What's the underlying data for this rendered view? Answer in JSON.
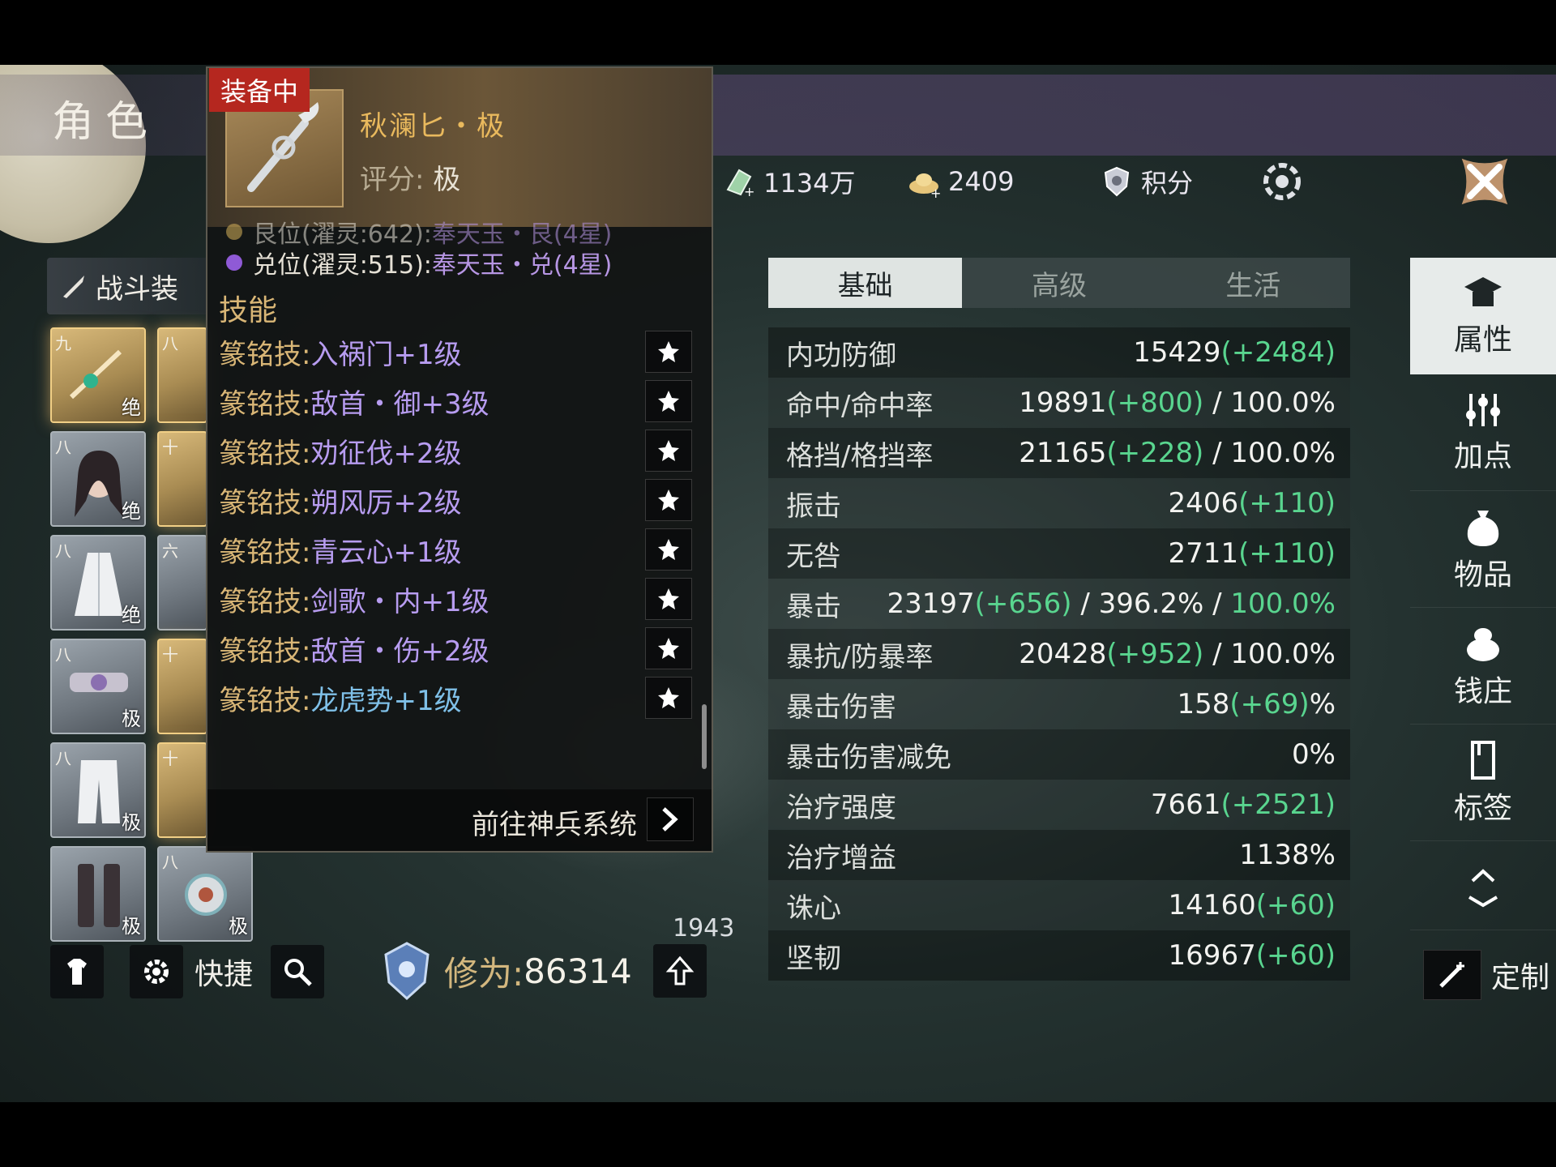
{
  "header": {
    "title": "角色"
  },
  "resources": [
    {
      "icon": "jade-icon",
      "value": "1134万"
    },
    {
      "icon": "ingot-icon",
      "value": "2409"
    },
    {
      "icon": "shield-points-icon",
      "value": "积分"
    }
  ],
  "left": {
    "loadout_label": "战斗装",
    "slots": [
      {
        "tier": "九",
        "grade": "绝"
      },
      {
        "tier": "八",
        "grade": ""
      },
      {
        "tier": "八",
        "grade": "绝"
      },
      {
        "tier": "十",
        "grade": ""
      },
      {
        "tier": "八",
        "grade": "绝"
      },
      {
        "tier": "六",
        "grade": ""
      },
      {
        "tier": "八",
        "grade": "极"
      },
      {
        "tier": "十",
        "grade": ""
      },
      {
        "tier": "八",
        "grade": "极"
      },
      {
        "tier": "十",
        "grade": ""
      },
      {
        "tier": "",
        "grade": "极"
      },
      {
        "tier": "八",
        "grade": "极"
      }
    ],
    "quick_label": "快捷",
    "cultivation_label": "修为:",
    "cultivation_value": "86314",
    "level_badge": "1943"
  },
  "tooltip": {
    "equipped_tag": "装备中",
    "item_name": "秋澜匕・极",
    "score_label": "评分:",
    "score_value": "极",
    "gems": [
      {
        "label": "艮位(濯灵:642):",
        "value": "奉天玉・艮(4星)"
      },
      {
        "label": "兑位(濯灵:515):",
        "value": "奉天玉・兑(4星)"
      }
    ],
    "skills_heading": "技能",
    "skill_prefix": "篆铭技:",
    "skills": [
      {
        "name": "入祸门",
        "level": "+1级"
      },
      {
        "name": "敌首・御",
        "level": "+3级"
      },
      {
        "name": "劝征伐",
        "level": "+2级"
      },
      {
        "name": "朔风厉",
        "level": "+2级"
      },
      {
        "name": "青云心",
        "level": "+1级"
      },
      {
        "name": "剑歌・内",
        "level": "+1级"
      },
      {
        "name": "敌首・伤",
        "level": "+2级"
      },
      {
        "name": "龙虎势",
        "level": "+1级"
      }
    ],
    "goto_label": "前往神兵系统"
  },
  "stats_panel": {
    "tabs": [
      "基础",
      "高级",
      "生活"
    ],
    "rows": [
      {
        "label": "内功防御",
        "base": "15429",
        "bonus": "(+2484)",
        "tail": ""
      },
      {
        "label": "命中/命中率",
        "base": "19891",
        "bonus": "(+800)",
        "tail": " / 100.0%"
      },
      {
        "label": "格挡/格挡率",
        "base": "21165",
        "bonus": "(+228)",
        "tail": " / 100.0%"
      },
      {
        "label": "振击",
        "base": "2406",
        "bonus": "(+110)",
        "tail": ""
      },
      {
        "label": "无咎",
        "base": "2711",
        "bonus": "(+110)",
        "tail": ""
      },
      {
        "label": "暴击",
        "base": "23197",
        "bonus": "(+656)",
        "tail": " / 396.2% / ",
        "tail_green": "100.0%"
      },
      {
        "label": "暴抗/防暴率",
        "base": "20428",
        "bonus": "(+952)",
        "tail": " / 100.0%"
      },
      {
        "label": "暴击伤害",
        "base": "158",
        "bonus": "(+69)",
        "tail": "%"
      },
      {
        "label": "暴击伤害减免",
        "base": "0%",
        "bonus": "",
        "tail": ""
      },
      {
        "label": "治疗强度",
        "base": "7661",
        "bonus": "(+2521)",
        "tail": ""
      },
      {
        "label": "治疗增益",
        "base": "1138%",
        "bonus": "",
        "tail": ""
      },
      {
        "label": "诛心",
        "base": "14160",
        "bonus": "(+60)",
        "tail": ""
      },
      {
        "label": "坚韧",
        "base": "16967",
        "bonus": "(+60)",
        "tail": ""
      }
    ]
  },
  "side_nav": {
    "items": [
      "属性",
      "加点",
      "物品",
      "钱庄",
      "标签"
    ],
    "customize_label": "定制"
  },
  "colors": {
    "accent_gold": "#d9b676",
    "bonus_green": "#59d58f",
    "purple": "#b79cf0",
    "equipped_red": "#b5271f"
  }
}
